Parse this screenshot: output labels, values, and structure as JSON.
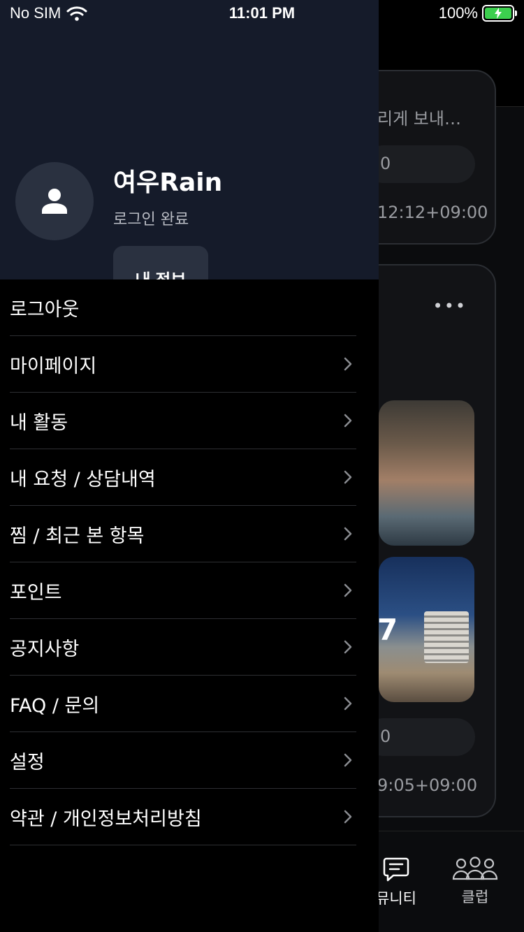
{
  "status_bar": {
    "carrier": "No SIM",
    "time": "11:01 PM",
    "battery": "100%",
    "battery_level": 1.0
  },
  "background": {
    "card1": {
      "text": "리게 보내…",
      "pill": "0",
      "timestamp": "12:12+09:00"
    },
    "card2": {
      "more": "•••",
      "photo2_overlay": "7",
      "pill": "0",
      "timestamp": "9:05+09:00"
    },
    "tabs": [
      {
        "label": "뮤니티",
        "icon": "chat-icon"
      },
      {
        "label": "클럽",
        "icon": "group-icon"
      }
    ]
  },
  "drawer": {
    "user": {
      "name": "여우Rain",
      "status": "로그인 완료"
    },
    "info_button": "내 정보",
    "menu": [
      {
        "label": "로그아웃",
        "chevron": false
      },
      {
        "label": "마이페이지",
        "chevron": true
      },
      {
        "label": "내 활동",
        "chevron": true
      },
      {
        "label": "내 요청 / 상담내역",
        "chevron": true
      },
      {
        "label": "찜 / 최근 본 항목",
        "chevron": true
      },
      {
        "label": "포인트",
        "chevron": true
      },
      {
        "label": "공지사항",
        "chevron": true
      },
      {
        "label": "FAQ / 문의",
        "chevron": true
      },
      {
        "label": "설정",
        "chevron": true
      },
      {
        "label": "약관 / 개인정보처리방침",
        "chevron": true
      }
    ]
  }
}
